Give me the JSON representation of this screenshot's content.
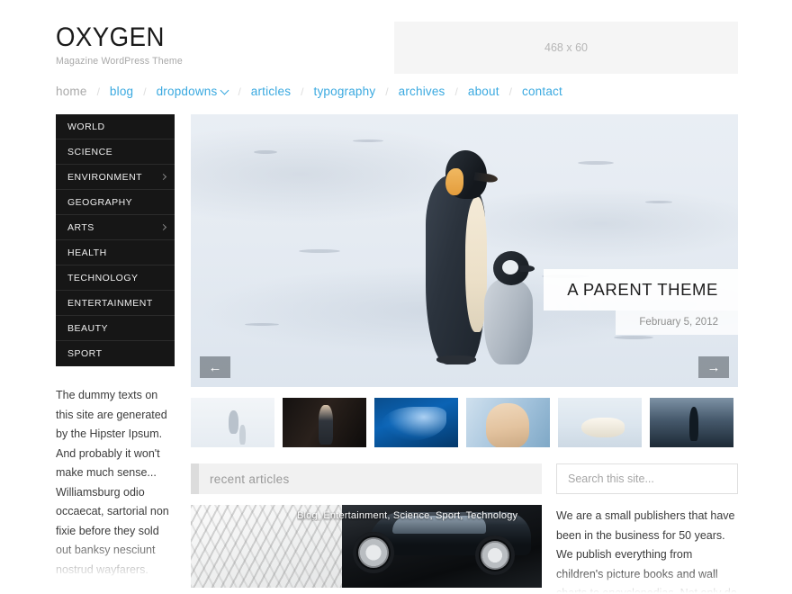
{
  "site": {
    "logo": "OXYGEN",
    "tagline": "Magazine WordPress Theme",
    "banner_label": "468 x 60"
  },
  "nav": {
    "separator": "/",
    "items": [
      {
        "label": "home",
        "current": true,
        "has_dropdown": false
      },
      {
        "label": "blog",
        "current": false,
        "has_dropdown": false
      },
      {
        "label": "dropdowns",
        "current": false,
        "has_dropdown": true
      },
      {
        "label": "articles",
        "current": false,
        "has_dropdown": false
      },
      {
        "label": "typography",
        "current": false,
        "has_dropdown": false
      },
      {
        "label": "archives",
        "current": false,
        "has_dropdown": false
      },
      {
        "label": "about",
        "current": false,
        "has_dropdown": false
      },
      {
        "label": "contact",
        "current": false,
        "has_dropdown": false
      }
    ]
  },
  "sidebar": {
    "categories": [
      {
        "label": "WORLD",
        "submenu": false
      },
      {
        "label": "SCIENCE",
        "submenu": false
      },
      {
        "label": "ENVIRONMENT",
        "submenu": true
      },
      {
        "label": "GEOGRAPHY",
        "submenu": false
      },
      {
        "label": "ARTS",
        "submenu": true
      },
      {
        "label": "HEALTH",
        "submenu": false
      },
      {
        "label": "TECHNOLOGY",
        "submenu": false
      },
      {
        "label": "ENTERTAINMENT",
        "submenu": false
      },
      {
        "label": "BEAUTY",
        "submenu": false
      },
      {
        "label": "SPORT",
        "submenu": false
      }
    ],
    "text": "The dummy texts on this site are generated by the Hipster Ipsum. And probably it won't make much sense... Williamsburg odio occaecat, sartorial non fixie before they sold out banksy nesciunt nostrud wayfarers. Carles ullamco delectus culpa, cupidatat qui tempor biodiesel lo-fi butcher minim williamsburg. American apparel organic brunch, gluten-free freegan whatever"
  },
  "slider": {
    "title": "A PARENT THEME",
    "date": "February 5, 2012",
    "prev_label": "←",
    "next_label": "→",
    "thumbnails": [
      {
        "alt": "penguin-and-chick-on-snow"
      },
      {
        "alt": "woman-in-dark-doorway"
      },
      {
        "alt": "blue-underwater-whale"
      },
      {
        "alt": "blonde-fashion-model"
      },
      {
        "alt": "polar-bear-on-ice"
      },
      {
        "alt": "silhouette-on-mountain"
      }
    ]
  },
  "recent": {
    "heading": "recent articles",
    "article": {
      "categories": "Blog, Entertainment, Science, Sport, Technology",
      "image_alt": "black-car-on-cobblestone-road"
    }
  },
  "search": {
    "placeholder": "Search this site...",
    "value": ""
  },
  "about": {
    "text": "We are a small publishers that have been in the business for 50 years. We publish everything from children's picture books and wall charts to encyclopedias. Not only do we publish in the classic paper format, but we also have an eTheme, as we like to call them"
  },
  "colors": {
    "accent": "#3aa9e0",
    "menu_bg": "#161616",
    "banner_bg": "#f5f5f5",
    "section_head_bg": "#f1f1f1"
  }
}
